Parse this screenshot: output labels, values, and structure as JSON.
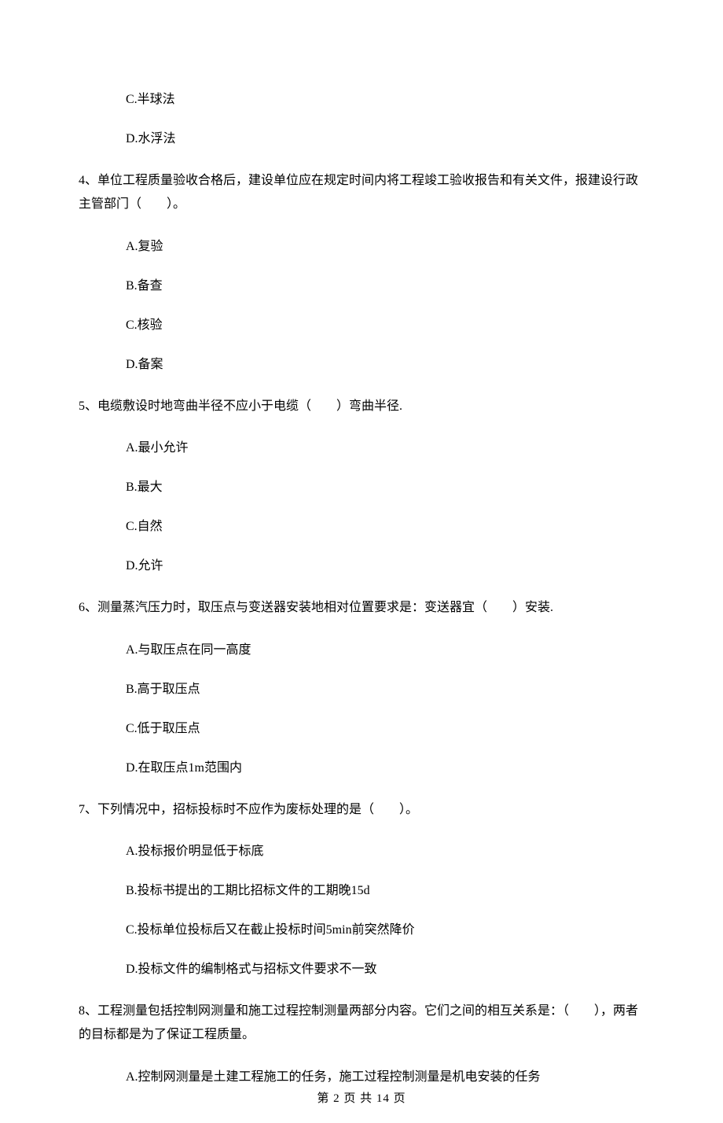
{
  "q3": {
    "options": {
      "c": "C.半球法",
      "d": "D.水浮法"
    }
  },
  "q4": {
    "text": "4、单位工程质量验收合格后，建设单位应在规定时间内将工程竣工验收报告和有关文件，报建设行政主管部门（　　）。",
    "options": {
      "a": "A.复验",
      "b": "B.备查",
      "c": "C.核验",
      "d": "D.备案"
    }
  },
  "q5": {
    "text": "5、电缆敷设时地弯曲半径不应小于电缆（　　）弯曲半径.",
    "options": {
      "a": "A.最小允许",
      "b": "B.最大",
      "c": "C.自然",
      "d": "D.允许"
    }
  },
  "q6": {
    "text": "6、测量蒸汽压力时，取压点与变送器安装地相对位置要求是：变送器宜（　　）安装.",
    "options": {
      "a": "A.与取压点在同一高度",
      "b": "B.高于取压点",
      "c": "C.低于取压点",
      "d": "D.在取压点1m范围内"
    }
  },
  "q7": {
    "text": "7、下列情况中，招标投标时不应作为废标处理的是（　　）。",
    "options": {
      "a": "A.投标报价明显低于标底",
      "b": "B.投标书提出的工期比招标文件的工期晚15d",
      "c": "C.投标单位投标后又在截止投标时间5min前突然降价",
      "d": "D.投标文件的编制格式与招标文件要求不一致"
    }
  },
  "q8": {
    "text": "8、工程测量包括控制网测量和施工过程控制测量两部分内容。它们之间的相互关系是：（　　），两者的目标都是为了保证工程质量。",
    "options": {
      "a": "A.控制网测量是土建工程施工的任务，施工过程控制测量是机电安装的任务"
    }
  },
  "footer": "第 2 页 共 14 页"
}
